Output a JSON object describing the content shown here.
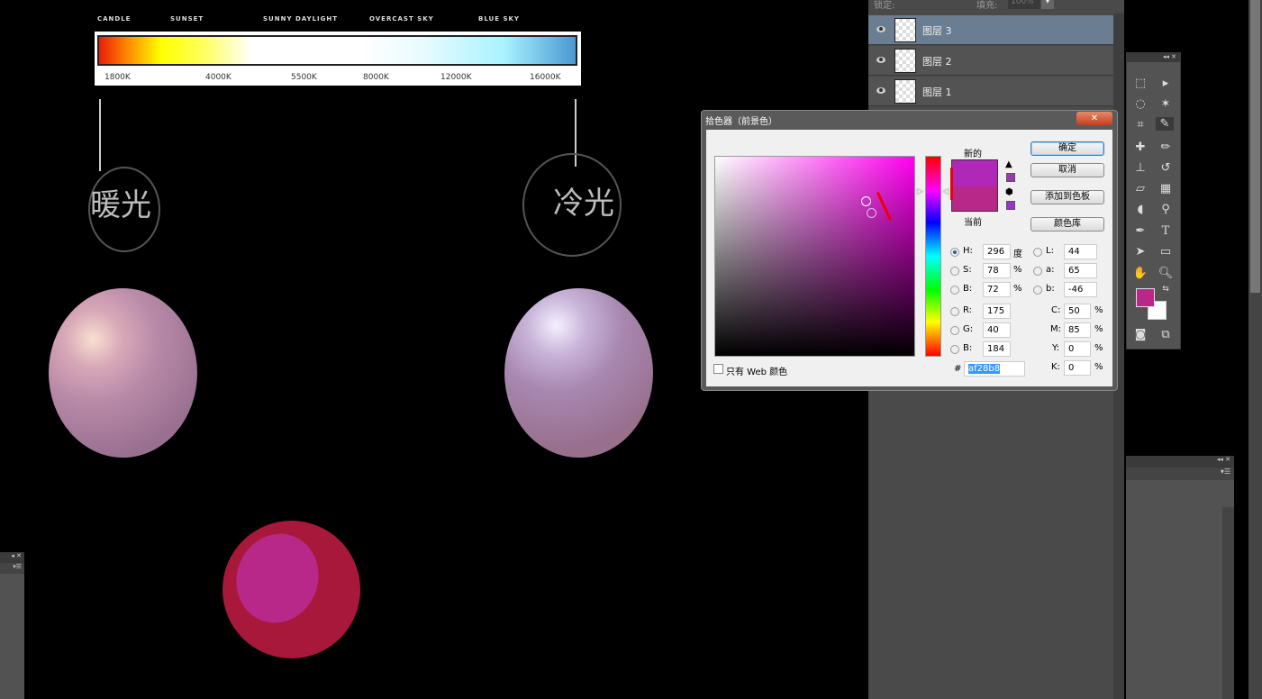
{
  "kelvin_chart": {
    "labels": [
      "CANDLE",
      "SUNSET",
      "SUNNY DAYLIGHT",
      "OVERCAST SKY",
      "BLUE SKY"
    ],
    "ticks": [
      "1800K",
      "4000K",
      "5500K",
      "8000K",
      "12000K",
      "16000K"
    ]
  },
  "canvas": {
    "warm_label": "暖光",
    "cool_label": "冷光"
  },
  "layers_panel": {
    "lock_label": "锁定:",
    "fill_label": "填充:",
    "fill_value": "100%",
    "layers": [
      {
        "name": "图层 3",
        "selected": true
      },
      {
        "name": "图层 2",
        "selected": false
      },
      {
        "name": "图层 1",
        "selected": false
      }
    ]
  },
  "color_picker": {
    "title": "拾色器（前景色）",
    "new_label": "新的",
    "current_label": "当前",
    "new_color": "#af28b8",
    "current_color": "#b82888",
    "buttons": {
      "ok": "确定",
      "cancel": "取消",
      "add_to_swatches": "添加到色板",
      "color_libraries": "颜色库"
    },
    "fields": {
      "H": {
        "label": "H:",
        "value": "296",
        "unit": "度"
      },
      "S": {
        "label": "S:",
        "value": "78",
        "unit": "%"
      },
      "Bv": {
        "label": "B:",
        "value": "72",
        "unit": "%"
      },
      "R": {
        "label": "R:",
        "value": "175"
      },
      "G": {
        "label": "G:",
        "value": "40"
      },
      "Bc": {
        "label": "B:",
        "value": "184"
      },
      "L": {
        "label": "L:",
        "value": "44"
      },
      "a": {
        "label": "a:",
        "value": "65"
      },
      "b": {
        "label": "b:",
        "value": "-46"
      },
      "C": {
        "label": "C:",
        "value": "50",
        "unit": "%"
      },
      "M": {
        "label": "M:",
        "value": "85",
        "unit": "%"
      },
      "Y": {
        "label": "Y:",
        "value": "0",
        "unit": "%"
      },
      "K": {
        "label": "K:",
        "value": "0",
        "unit": "%"
      }
    },
    "hex_label": "#",
    "hex_value": "af28b8",
    "web_only_label": "只有 Web 颜色",
    "hue_color": "#ff00f0"
  },
  "toolbox": {
    "foreground_color": "#b82888",
    "background_color": "#ffffff"
  }
}
